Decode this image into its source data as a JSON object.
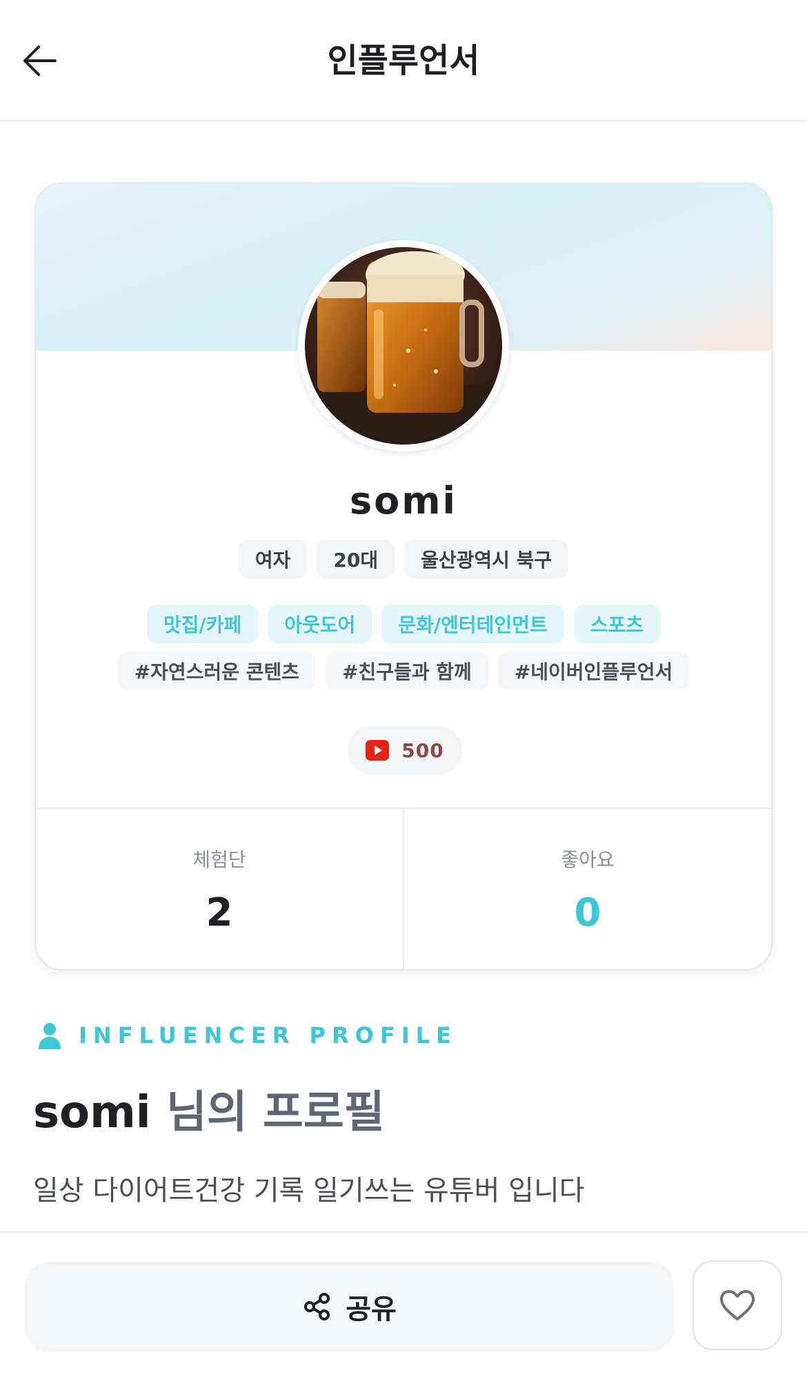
{
  "header": {
    "title": "인플루언서"
  },
  "profile_card": {
    "name": "somi",
    "info_chips": [
      "여자",
      "20대",
      "울산광역시 북구"
    ],
    "categories": [
      "맛집/카페",
      "아웃도어",
      "문화/엔터테인먼트",
      "스포츠"
    ],
    "hashtags": [
      "#자연스러운 콘텐츠",
      "#친구들과 함께",
      "#네이버인플루언서"
    ],
    "youtube": {
      "icon": "youtube-icon",
      "count": "500"
    },
    "stats": [
      {
        "label": "체험단",
        "value": "2"
      },
      {
        "label": "좋아요",
        "value": "0"
      }
    ]
  },
  "section": {
    "eyebrow": "INFLUENCER PROFILE",
    "title_name": "somi",
    "title_suffix": " 님의 프로필",
    "bio": "일상 다이어트건강 기록 일기쓰는 유튜버 입니다"
  },
  "bottom_bar": {
    "share_label": "공유"
  },
  "colors": {
    "accent": "#3cc6d6",
    "text": "#1f2124",
    "youtube": "#e62117"
  }
}
